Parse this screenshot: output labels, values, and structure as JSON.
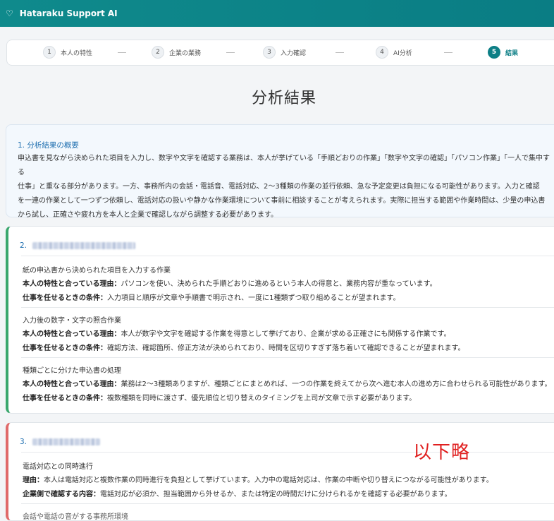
{
  "app": {
    "title": "Hataraku Support AI",
    "icon": "heart-outline-icon"
  },
  "stepper": [
    {
      "num": "1",
      "label": "本人の特性",
      "active": false
    },
    {
      "num": "2",
      "label": "企業の業務",
      "active": false
    },
    {
      "num": "3",
      "label": "入力確認",
      "active": false
    },
    {
      "num": "4",
      "label": "AI分析",
      "active": false
    },
    {
      "num": "5",
      "label": "結果",
      "active": true
    }
  ],
  "page_title": "分析結果",
  "summary": {
    "heading": "1.  分析結果の概要",
    "lines": [
      "申込書を見ながら決められた項目を入力し、数字や文字を確認する業務は、本人が挙げている「手順どおりの作業」「数字や文字の確認」「パソコン作業」「一人で集中する",
      "仕事」と重なる部分があります。一方、事務所内の会話・電話音、電話対応、2～3種類の作業の並行依頼、急な予定変更は負担になる可能性があります。入力と確認",
      "を一連の作業として一つずつ依頼し、電話対応の扱いや静かな作業環境について事前に相談することが考えられます。実際に担当する範囲や作業時間は、少量の申込書",
      "から試し、正確さや疲れ方を本人と企業で確認しながら調整する必要があります。"
    ]
  },
  "section2": {
    "heading": "2.",
    "items": [
      {
        "title": "紙の申込書から決められた項目を入力する作業",
        "reason_label": "本人の特性と合っている理由：",
        "reason": "パソコンを使い、決められた手順どおりに進めるという本人の得意と、業務内容が重なっています。",
        "cond_label": "仕事を任せるときの条件：",
        "cond": "入力項目と順序が文章や手順書で明示され、一度に1種類ずつ取り組めることが望まれます。"
      },
      {
        "title": "入力後の数字・文字の照合作業",
        "reason_label": "本人の特性と合っている理由：",
        "reason": "本人が数字や文字を確認する作業を得意として挙げており、企業が求める正確さにも関係する作業です。",
        "cond_label": "仕事を任せるときの条件：",
        "cond": "確認方法、確認箇所、修正方法が決められており、時間を区切りすぎず落ち着いて確認できることが望まれます。"
      },
      {
        "title": "種類ごとに分けた申込書の処理",
        "reason_label": "本人の特性と合っている理由：",
        "reason": "業務は2～3種類ありますが、種類ごとにまとめれば、一つの作業を終えてから次へ進む本人の進め方に合わせられる可能性があります。",
        "cond_label": "仕事を任せるときの条件：",
        "cond": "複数種類を同時に渡さず、優先順位と切り替えのタイミングを上司が文章で示す必要があります。"
      }
    ]
  },
  "section3": {
    "heading": "3.",
    "items": [
      {
        "title": "電話対応との同時進行",
        "reason_label": "理由：",
        "reason": "本人は電話対応と複数作業の同時進行を負担として挙げています。入力中の電話対応は、作業の中断や切り替えにつながる可能性があります。",
        "cond_label": "企業側で確認する内容：",
        "cond": "電話対応が必須か、担当範囲から外せるか、または特定の時間だけに分けられるかを確認する必要があります。"
      },
      {
        "title": "会話や電話の音がする事務所環境"
      }
    ]
  },
  "overlay_note": "以下略",
  "colors": {
    "header": "#0d7f86",
    "green_accent": "#3aa76d",
    "red_accent": "#e06a6a",
    "link_blue": "#1f6fb0",
    "note_red": "#e02020"
  }
}
